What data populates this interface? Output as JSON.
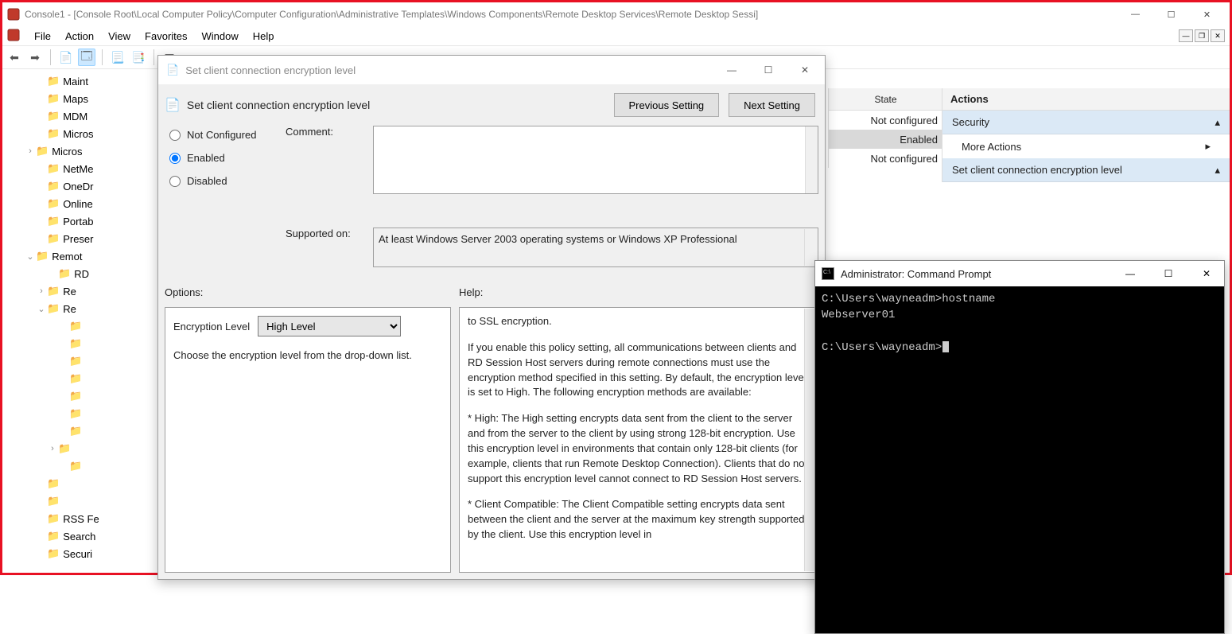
{
  "window": {
    "title": "Console1 - [Console Root\\Local Computer Policy\\Computer Configuration\\Administrative Templates\\Windows Components\\Remote Desktop Services\\Remote Desktop Sessi]"
  },
  "menubar": [
    "File",
    "Action",
    "View",
    "Favorites",
    "Window",
    "Help"
  ],
  "tree": [
    {
      "indent": 3,
      "exp": "",
      "label": "Maint"
    },
    {
      "indent": 3,
      "exp": "",
      "label": "Maps"
    },
    {
      "indent": 3,
      "exp": "",
      "label": "MDM"
    },
    {
      "indent": 3,
      "exp": "",
      "label": "Micros"
    },
    {
      "indent": 2,
      "exp": ">",
      "label": "Micros"
    },
    {
      "indent": 3,
      "exp": "",
      "label": "NetMe"
    },
    {
      "indent": 3,
      "exp": "",
      "label": "OneDr"
    },
    {
      "indent": 3,
      "exp": "",
      "label": "Online"
    },
    {
      "indent": 3,
      "exp": "",
      "label": "Portab"
    },
    {
      "indent": 3,
      "exp": "",
      "label": "Preser"
    },
    {
      "indent": 2,
      "exp": "v",
      "label": "Remot"
    },
    {
      "indent": 4,
      "exp": "",
      "label": "RD"
    },
    {
      "indent": 3,
      "exp": ">",
      "label": "Re"
    },
    {
      "indent": 3,
      "exp": "v",
      "label": "Re"
    },
    {
      "indent": 5,
      "exp": "",
      "label": ""
    },
    {
      "indent": 5,
      "exp": "",
      "label": ""
    },
    {
      "indent": 5,
      "exp": "",
      "label": ""
    },
    {
      "indent": 5,
      "exp": "",
      "label": ""
    },
    {
      "indent": 5,
      "exp": "",
      "label": ""
    },
    {
      "indent": 5,
      "exp": "",
      "label": ""
    },
    {
      "indent": 5,
      "exp": "",
      "label": ""
    },
    {
      "indent": 4,
      "exp": ">",
      "label": ""
    },
    {
      "indent": 5,
      "exp": "",
      "label": ""
    },
    {
      "indent": 3,
      "exp": "",
      "label": ""
    },
    {
      "indent": 3,
      "exp": "",
      "label": ""
    },
    {
      "indent": 3,
      "exp": "",
      "label": "RSS Fe"
    },
    {
      "indent": 3,
      "exp": "",
      "label": "Search"
    },
    {
      "indent": 3,
      "exp": "",
      "label": "Securi"
    }
  ],
  "stateCol": {
    "header": "State",
    "rows": [
      {
        "text": "Not configured",
        "sel": false
      },
      {
        "text": "Enabled",
        "sel": true
      },
      {
        "text": "Not configured",
        "sel": false
      }
    ]
  },
  "actions": {
    "header": "Actions",
    "section1": "Security",
    "item1": "More Actions",
    "section2": "Set client connection encryption level"
  },
  "dialog": {
    "title": "Set client connection encryption level",
    "header": "Set client connection encryption level",
    "prevBtn": "Previous Setting",
    "nextBtn": "Next Setting",
    "radioNotConfigured": "Not Configured",
    "radioEnabled": "Enabled",
    "radioDisabled": "Disabled",
    "commentLabel": "Comment:",
    "commentValue": "",
    "supportedLabel": "Supported on:",
    "supportedValue": "At least Windows Server 2003 operating systems or Windows XP Professional",
    "optionsLabel": "Options:",
    "helpLabel": "Help:",
    "encLevelLabel": "Encryption Level",
    "encLevelValue": "High Level",
    "encHint": "Choose the encryption level from the drop-down list.",
    "helpText1": "to SSL encryption.",
    "helpText2": "If you enable this policy setting, all communications between clients and RD Session Host servers during remote connections must use the encryption method specified in this setting. By default, the encryption level is set to High. The following encryption methods are available:",
    "helpText3": "* High: The High setting encrypts data sent from the client to the server and from the server to the client by using strong 128-bit encryption. Use this encryption level in environments that contain only 128-bit clients (for example, clients that run Remote Desktop Connection). Clients that do not support this encryption level cannot connect to RD Session Host servers.",
    "helpText4": "* Client Compatible: The Client Compatible setting encrypts data sent between the client and the server at the maximum key strength supported by the client. Use this encryption level in"
  },
  "cmd": {
    "title": "Administrator: Command Prompt",
    "line1": "C:\\Users\\wayneadm>hostname",
    "line2": "Webserver01",
    "line3": "",
    "line4": "C:\\Users\\wayneadm>"
  }
}
